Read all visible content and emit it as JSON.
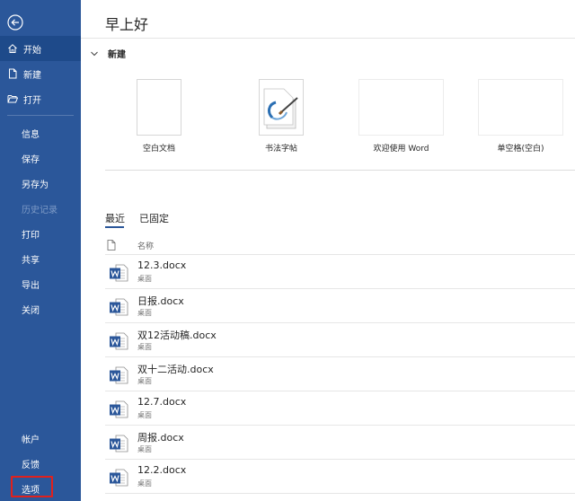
{
  "sidebar": {
    "items": [
      {
        "label": "开始",
        "icon": "home-icon"
      },
      {
        "label": "新建",
        "icon": "new-doc-icon"
      },
      {
        "label": "打开",
        "icon": "folder-open-icon"
      },
      {
        "label": "信息"
      },
      {
        "label": "保存"
      },
      {
        "label": "另存为"
      },
      {
        "label": "历史记录"
      },
      {
        "label": "打印"
      },
      {
        "label": "共享"
      },
      {
        "label": "导出"
      },
      {
        "label": "关闭"
      }
    ],
    "bottom_items": [
      {
        "label": "帐户"
      },
      {
        "label": "反馈"
      },
      {
        "label": "选项"
      }
    ]
  },
  "main": {
    "greeting": "早上好",
    "new_section_title": "新建",
    "templates": [
      {
        "label": "空白文档"
      },
      {
        "label": "书法字帖"
      },
      {
        "label": "欢迎使用 Word"
      },
      {
        "label": "单空格(空白)"
      }
    ],
    "tabs": [
      {
        "label": "最近"
      },
      {
        "label": "已固定"
      }
    ],
    "column_name": "名称",
    "files": [
      {
        "name": "12.3.docx",
        "location": "桌面"
      },
      {
        "name": "日报.docx",
        "location": "桌面"
      },
      {
        "name": "双12活动稿.docx",
        "location": "桌面"
      },
      {
        "name": "双十二活动.docx",
        "location": "桌面"
      },
      {
        "name": "12.7.docx",
        "location": "桌面"
      },
      {
        "name": "周报.docx",
        "location": "桌面"
      },
      {
        "name": "12.2.docx",
        "location": "桌面"
      }
    ]
  },
  "colors": {
    "sidebar_bg": "#2b579a",
    "sidebar_active": "#1e4a8a",
    "word_blue": "#2b579a",
    "highlight_red": "#e0211d"
  }
}
